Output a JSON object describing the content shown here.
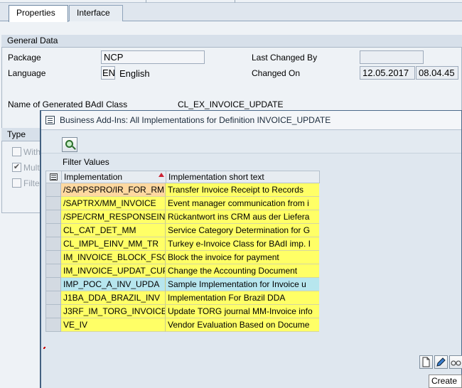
{
  "tabs": [
    {
      "label": "Properties",
      "active": true
    },
    {
      "label": "Interface",
      "active": false
    }
  ],
  "general_data": {
    "title": "General Data",
    "package_label": "Package",
    "package_value": "NCP",
    "language_label": "Language",
    "language_code": "EN",
    "language_name": "English",
    "last_changed_by_label": "Last Changed By",
    "last_changed_by_value": "",
    "changed_on_label": "Changed On",
    "changed_on_date": "12.05.2017",
    "changed_on_time": "08.04.45",
    "generated_class_label": "Name of Generated BAdI Class",
    "generated_class_value": "CL_EX_INVOICE_UPDATE"
  },
  "type_group": {
    "title": "Type",
    "options": [
      {
        "label": "With",
        "checked": false
      },
      {
        "label": "Multi",
        "checked": true
      },
      {
        "label": "Filte",
        "checked": false
      }
    ]
  },
  "dialog": {
    "title": "Business Add-Ins: All Implementations for Definition INVOICE_UPDATE",
    "filter_label": "Filter Values",
    "columns": {
      "implementation": "Implementation",
      "short_text": "Implementation short text"
    },
    "rows": [
      {
        "impl": "/SAPPSPRO/IR_FOR_RM",
        "text": "Transfer Invoice Receipt to Records"
      },
      {
        "impl": "/SAPTRX/MM_INVOICE",
        "text": "Event manager communication from i"
      },
      {
        "impl": "/SPE/CRM_RESPONSEINV",
        "text": "Rückantwort ins CRM aus der Liefera"
      },
      {
        "impl": "CL_CAT_DET_MM",
        "text": "Service Category Determination for G"
      },
      {
        "impl": "CL_IMPL_EINV_MM_TR",
        "text": "Turkey e-Invoice Class for BAdI imp. I"
      },
      {
        "impl": "IM_INVOICE_BLOCK_FSC",
        "text": "Block the invoice for payment"
      },
      {
        "impl": "IM_INVOICE_UPDAT_CUP",
        "text": "Change the Accounting Document"
      },
      {
        "impl": "IMP_POC_A_INV_UPDA",
        "text": "Sample Implementation for Invoice u"
      },
      {
        "impl": "J1BA_DDA_BRAZIL_INV",
        "text": "Implementation For Brazil DDA"
      },
      {
        "impl": "J3RF_IM_TORG_INVOICE",
        "text": "Update TORG journal MM-Invoice info"
      },
      {
        "impl": "VE_IV",
        "text": "Vendor Evaluation Based on Docume"
      }
    ],
    "selected_row": 7,
    "tooltip": "Create"
  }
}
